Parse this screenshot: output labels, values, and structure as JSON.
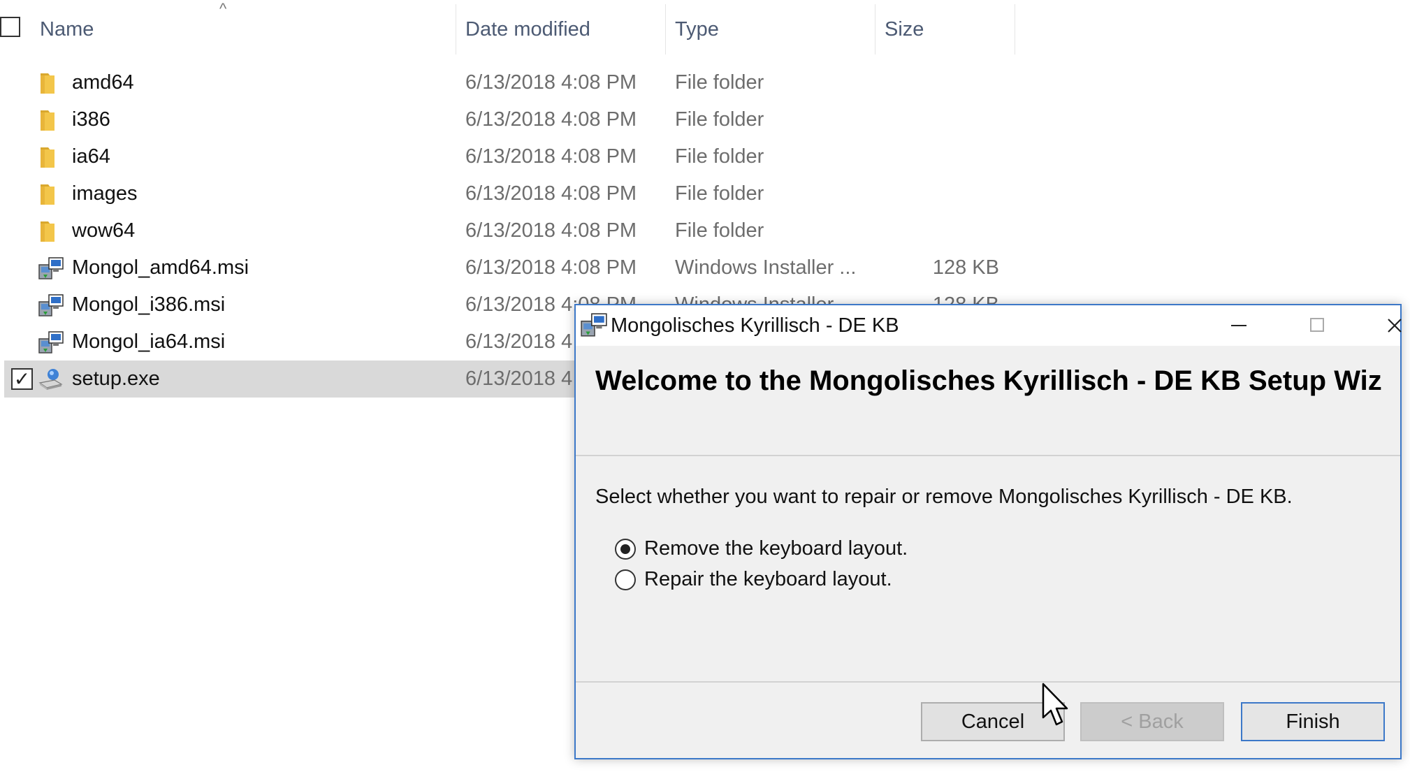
{
  "explorer": {
    "columns": {
      "name": "Name",
      "date_modified": "Date modified",
      "type": "Type",
      "size": "Size"
    },
    "rows": [
      {
        "name": "amd64",
        "date": "6/13/2018 4:08 PM",
        "type": "File folder",
        "size": "",
        "icon": "folder-icon"
      },
      {
        "name": "i386",
        "date": "6/13/2018 4:08 PM",
        "type": "File folder",
        "size": "",
        "icon": "folder-icon"
      },
      {
        "name": "ia64",
        "date": "6/13/2018 4:08 PM",
        "type": "File folder",
        "size": "",
        "icon": "folder-icon"
      },
      {
        "name": "images",
        "date": "6/13/2018 4:08 PM",
        "type": "File folder",
        "size": "",
        "icon": "folder-icon"
      },
      {
        "name": "wow64",
        "date": "6/13/2018 4:08 PM",
        "type": "File folder",
        "size": "",
        "icon": "folder-icon"
      },
      {
        "name": "Mongol_amd64.msi",
        "date": "6/13/2018 4:08 PM",
        "type": "Windows Installer ...",
        "size": "128 KB",
        "icon": "msi-installer-icon"
      },
      {
        "name": "Mongol_i386.msi",
        "date": "6/13/2018 4:08 PM",
        "type": "Windows Installer ...",
        "size": "128 KB",
        "icon": "msi-installer-icon"
      },
      {
        "name": "Mongol_ia64.msi",
        "date": "6/13/2018 4",
        "type": "",
        "size": "",
        "icon": "msi-installer-icon"
      },
      {
        "name": "setup.exe",
        "date": "6/13/2018 4",
        "type": "",
        "size": "",
        "icon": "setup-exe-icon",
        "selected": true
      }
    ]
  },
  "dialog": {
    "title": "Mongolisches Kyrillisch - DE KB",
    "heading": "Welcome to the Mongolisches Kyrillisch - DE KB Setup Wiz",
    "instruction": "Select whether you want to repair or remove Mongolisches Kyrillisch - DE KB.",
    "options": [
      {
        "label": "Remove the keyboard layout.",
        "checked": true
      },
      {
        "label": "Repair the keyboard layout.",
        "checked": false
      }
    ],
    "buttons": {
      "cancel": "Cancel",
      "back": "< Back",
      "finish": "Finish"
    }
  },
  "colors": {
    "dialog_border": "#3c78c8",
    "selected_row": "#d9d9d9",
    "header_text": "#4c5a73",
    "folder_yellow": "#f3c64a"
  }
}
